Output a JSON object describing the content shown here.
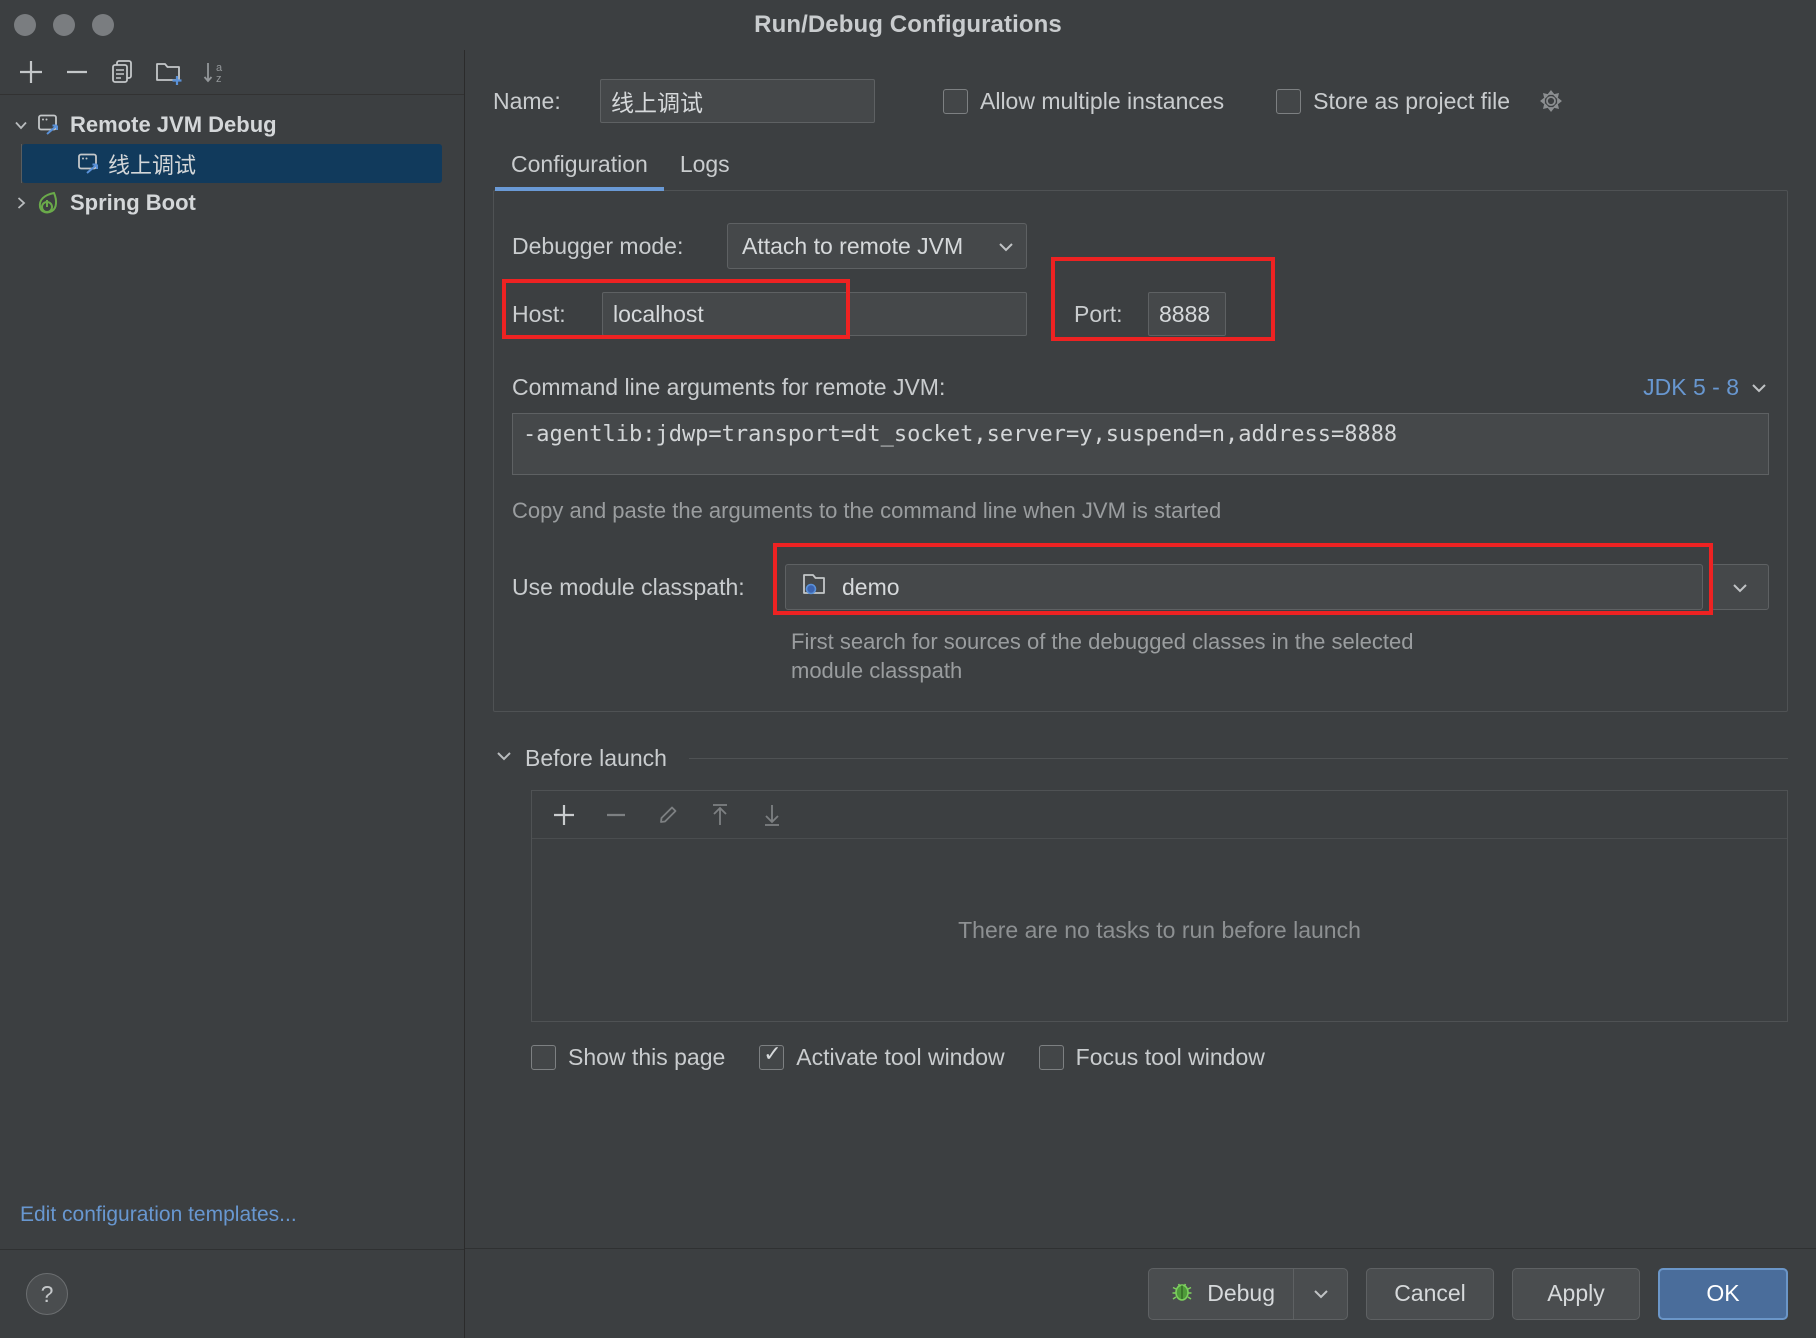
{
  "window": {
    "title": "Run/Debug Configurations"
  },
  "sidebar": {
    "toolbar": [
      {
        "name": "add-configuration-button",
        "icon": "plus-icon",
        "tooltip": "Add New Configuration"
      },
      {
        "name": "remove-configuration-button",
        "icon": "minus-icon",
        "tooltip": "Remove Configuration"
      },
      {
        "name": "copy-configuration-button",
        "icon": "copy-icon",
        "tooltip": "Copy Configuration"
      },
      {
        "name": "new-folder-button",
        "icon": "folder-plus-icon",
        "tooltip": "Create New Folder"
      },
      {
        "name": "sort-configurations-button",
        "icon": "sort-az-icon",
        "tooltip": "Sort Configurations"
      }
    ],
    "tree": [
      {
        "label": "Remote JVM Debug",
        "icon": "remote-jvm-debug-icon",
        "expanded": true,
        "level": 0,
        "selected": false
      },
      {
        "label": "线上调试",
        "icon": "remote-jvm-debug-icon",
        "level": 1,
        "selected": true
      },
      {
        "label": "Spring Boot",
        "icon": "spring-boot-icon",
        "expanded": false,
        "level": 0,
        "selected": false
      }
    ],
    "edit_templates_link": "Edit configuration templates...",
    "help_button": "?"
  },
  "form": {
    "name_label": "Name:",
    "name_value": "线上调试",
    "name_placeholder": "",
    "allow_multiple_instances": {
      "label": "Allow multiple instances",
      "checked": false
    },
    "store_as_project_file": {
      "label": "Store as project file",
      "checked": false,
      "gear_icon": "gear-icon"
    },
    "tabs": [
      {
        "label": "Configuration",
        "active": true
      },
      {
        "label": "Logs",
        "active": false
      }
    ],
    "debugger_mode": {
      "label": "Debugger mode:",
      "value": "Attach to remote JVM"
    },
    "host": {
      "label": "Host:",
      "value": "localhost",
      "highlighted": true
    },
    "port": {
      "label": "Port:",
      "value": "8888",
      "highlighted": true
    },
    "command_line": {
      "label": "Command line arguments for remote JVM:",
      "value": "-agentlib:jdwp=transport=dt_socket,server=y,suspend=n,address=8888",
      "hint": "Copy and paste the arguments to the command line when JVM is started",
      "jdk_selector": "JDK 5 - 8"
    },
    "module_classpath": {
      "label": "Use module classpath:",
      "value": "demo",
      "icon": "module-folder-icon",
      "hint_line1": "First search for sources of the debugged classes in the selected",
      "hint_line2": "module classpath",
      "highlighted": true
    }
  },
  "before_launch": {
    "title": "Before launch",
    "collapsed": false,
    "toolbar": [
      {
        "name": "add-task-button",
        "icon": "plus-icon",
        "enabled": true
      },
      {
        "name": "remove-task-button",
        "icon": "minus-icon",
        "enabled": false
      },
      {
        "name": "edit-task-button",
        "icon": "pencil-icon",
        "enabled": false
      },
      {
        "name": "move-task-up-button",
        "icon": "arrow-up-icon",
        "enabled": false
      },
      {
        "name": "move-task-down-button",
        "icon": "arrow-down-icon",
        "enabled": false
      }
    ],
    "empty_message": "There are no tasks to run before launch",
    "checks": [
      {
        "label": "Show this page",
        "checked": false
      },
      {
        "label": "Activate tool window",
        "checked": true
      },
      {
        "label": "Focus tool window",
        "checked": false
      }
    ]
  },
  "footer": {
    "debug_button": "Debug",
    "debug_icon": "bug-icon",
    "cancel_button": "Cancel",
    "apply_button": "Apply",
    "ok_button": "OK"
  },
  "colors": {
    "background": "#3c3f41",
    "selection": "#113a5c",
    "accent_blue": "#6897d0",
    "tab_underline": "#6a9ad6",
    "highlight_red": "#ee2222",
    "primary_button": "#4a6d9b",
    "text": "#c9ccce"
  }
}
